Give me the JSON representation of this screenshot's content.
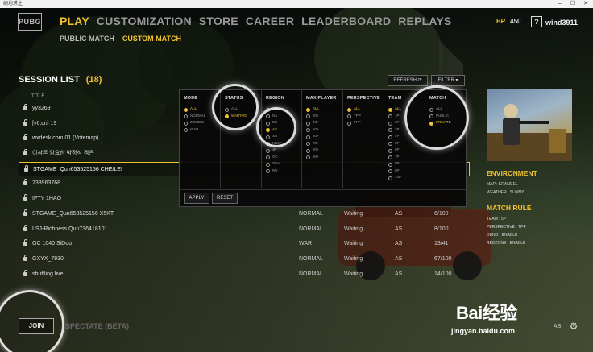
{
  "window": {
    "title": "絕地求生",
    "controls": [
      "–",
      "☐",
      "✕"
    ]
  },
  "header": {
    "logo": "PUBG",
    "nav": [
      "PLAY",
      "CUSTOMIZATION",
      "STORE",
      "CAREER",
      "LEADERBOARD",
      "REPLAYS"
    ],
    "subnav": [
      "PUBLIC MATCH",
      "CUSTOM MATCH"
    ],
    "bp_label": "BP",
    "bp_value": "450",
    "help": "?",
    "username": "wind3911"
  },
  "session_list": {
    "title": "SESSION LIST",
    "count": "(18)",
    "col_title": "TITLE",
    "refresh_label": "REFRESH ⟳",
    "filter_label": "FILTER ▾",
    "rows": [
      {
        "name": "yy3269",
        "mode": "",
        "status": "",
        "region": "",
        "players": ""
      },
      {
        "name": "[v6.cn] 19",
        "mode": "",
        "status": "",
        "region": "",
        "players": ""
      },
      {
        "name": "wxdesk.com 01 (Votemap)",
        "mode": "",
        "status": "",
        "region": "",
        "players": ""
      },
      {
        "name": "이참존 임요한 박정식 겜은",
        "mode": "",
        "status": "",
        "region": "",
        "players": ""
      },
      {
        "name": "STGAME_Qun653525156 CHE/LEI",
        "mode": "",
        "status": "",
        "region": "",
        "players": ""
      },
      {
        "name": "733963768",
        "mode": "",
        "status": "",
        "region": "",
        "players": ""
      },
      {
        "name": "IFTY 1HAO",
        "mode": "",
        "status": "",
        "region": "",
        "players": ""
      },
      {
        "name": "STGAME_Qun653525156 X5KT",
        "mode": "NORMAL",
        "status": "Waiting",
        "region": "AS",
        "players": "6/100"
      },
      {
        "name": "LSJ-Richness Qun736418101",
        "mode": "NORMAL",
        "status": "Waiting",
        "region": "AS",
        "players": "8/100"
      },
      {
        "name": "GC 1040 SiDou",
        "mode": "WAR",
        "status": "Waiting",
        "region": "AS",
        "players": "13/41"
      },
      {
        "name": "GXYX_7930",
        "mode": "NORMAL",
        "status": "Waiting",
        "region": "AS",
        "players": "67/100"
      },
      {
        "name": "shuffling live",
        "mode": "NORMAL",
        "status": "Waiting",
        "region": "AS",
        "players": "14/100"
      }
    ]
  },
  "filter_panel": {
    "columns": [
      {
        "header": "MODE",
        "options": [
          "ALL",
          "NORMAL",
          "ZOMBIE",
          "WAR"
        ],
        "selected": [
          0
        ]
      },
      {
        "header": "STATUS",
        "options": [
          "ALL",
          "WAITING"
        ],
        "selected": [
          1
        ]
      },
      {
        "header": "REGION",
        "options": [
          "ALL",
          "NA",
          "EU",
          "AS",
          "SA",
          "KRJP",
          "JP",
          "OC",
          "SEA",
          "RU"
        ],
        "selected": [
          3
        ]
      },
      {
        "header": "MAX PLAYER",
        "options": [
          "ALL",
          "20+",
          "40+",
          "50+",
          "60+",
          "70+",
          "80+",
          "90+"
        ],
        "selected": [
          0
        ]
      },
      {
        "header": "PERSPECTIVE",
        "options": [
          "ALL",
          "TPP",
          "FPP"
        ],
        "selected": [
          0
        ]
      },
      {
        "header": "TEAM",
        "options": [
          "ALL",
          "1P",
          "2P",
          "3P",
          "4P",
          "5P",
          "6P",
          "7P",
          "8P",
          "9P",
          "10P"
        ],
        "selected": [
          0
        ]
      },
      {
        "header": "MATCH",
        "options": [
          "ALL",
          "PUBLIC",
          "PRIVATE"
        ],
        "selected": [
          2
        ]
      }
    ],
    "apply_label": "APPLY",
    "reset_label": "RESET"
  },
  "details": {
    "environment_title": "ENVIRONMENT",
    "map_line": "MAP : ERANGEL",
    "weather_line": "WEATHER : SUNNY",
    "rule_title": "MATCH RULE",
    "team_line": "TEAM : 5P",
    "perspective_line": "PERSPECTIVE : TPP",
    "dbno_line": "DBNO : ENABLE",
    "redzone_line": "REDZONE : ENABLE"
  },
  "footer": {
    "join_label": "JOIN",
    "spectate_label": "SPECTATE (BETA)",
    "mas_label": "AS",
    "watermark_big": "Bai经验",
    "watermark_url": "jingyan.baidu.com"
  }
}
